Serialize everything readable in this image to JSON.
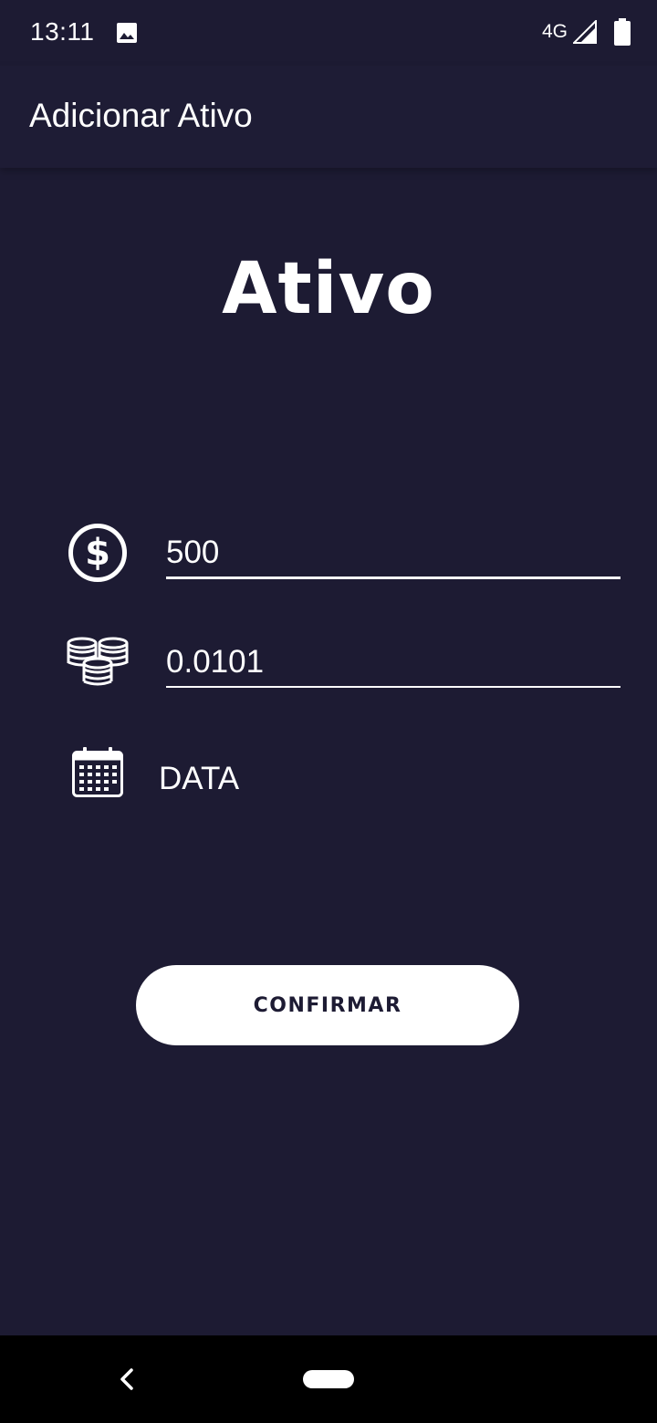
{
  "status_bar": {
    "time": "13:11",
    "network": "4G",
    "icons": [
      "image-icon",
      "signal-icon",
      "battery-icon"
    ]
  },
  "app_bar": {
    "title": "Adicionar Ativo"
  },
  "hero": {
    "title": "Ativo"
  },
  "form": {
    "amount": {
      "value": "500",
      "icon": "dollar-circle-icon"
    },
    "quantity": {
      "value": "0.0101",
      "icon": "coins-stack-icon"
    },
    "date": {
      "label": "DATA",
      "icon": "calendar-icon"
    }
  },
  "confirm_button": {
    "label": "CONFIRMAR"
  },
  "nav_bar": {
    "icons": [
      "back-icon",
      "home-icon"
    ]
  },
  "colors": {
    "background": "#1d1b33",
    "button": "#ffffff",
    "text": "#ffffff"
  }
}
